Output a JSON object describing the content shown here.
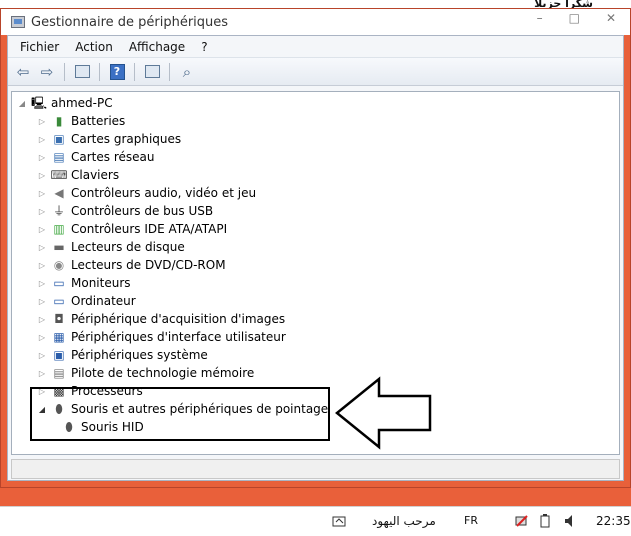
{
  "window": {
    "title": "Gestionnaire de périphériques",
    "bg_text": "شكرا جزيلا"
  },
  "menu": [
    "Fichier",
    "Action",
    "Affichage",
    "?"
  ],
  "tree": {
    "root": "ahmed-PC",
    "items": [
      {
        "label": "Batteries",
        "icon": "battery-icon"
      },
      {
        "label": "Cartes graphiques",
        "icon": "display-adapter-icon"
      },
      {
        "label": "Cartes réseau",
        "icon": "network-adapter-icon"
      },
      {
        "label": "Claviers",
        "icon": "keyboard-icon"
      },
      {
        "label": "Contrôleurs audio, vidéo et jeu",
        "icon": "speaker-icon"
      },
      {
        "label": "Contrôleurs de bus USB",
        "icon": "usb-icon"
      },
      {
        "label": "Contrôleurs IDE ATA/ATAPI",
        "icon": "ide-controller-icon"
      },
      {
        "label": "Lecteurs de disque",
        "icon": "disk-drive-icon"
      },
      {
        "label": "Lecteurs de DVD/CD-ROM",
        "icon": "dvd-drive-icon"
      },
      {
        "label": "Moniteurs",
        "icon": "monitor-icon"
      },
      {
        "label": "Ordinateur",
        "icon": "computer-icon"
      },
      {
        "label": "Périphérique d'acquisition d'images",
        "icon": "camera-icon"
      },
      {
        "label": "Périphériques d'interface utilisateur",
        "icon": "hid-icon"
      },
      {
        "label": "Périphériques système",
        "icon": "system-device-icon"
      },
      {
        "label": "Pilote de technologie mémoire",
        "icon": "memory-icon"
      },
      {
        "label": "Processeurs",
        "icon": "processor-icon"
      },
      {
        "label": "Souris et autres périphériques de pointage",
        "icon": "mouse-icon",
        "expanded": true
      }
    ],
    "child": {
      "label": "Souris HID",
      "icon": "mouse-icon"
    }
  },
  "taskbar": {
    "language": "FR",
    "greeting": "مرحب اليهود",
    "time": "22:35"
  },
  "colors": {
    "background": "#e9603a",
    "window_chrome": "#f4f6f9",
    "annotation": "#000000"
  }
}
